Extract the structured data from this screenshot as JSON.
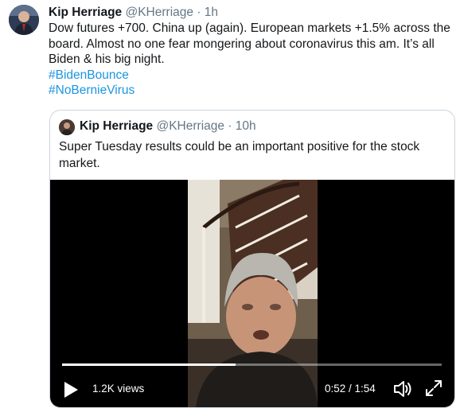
{
  "tweet": {
    "author_name": "Kip Herriage",
    "author_handle": "@KHerriage",
    "separator": "·",
    "time": "1h",
    "text": "Dow futures +700. China up (again). European markets +1.5% across the board. Almost no one fear mongering about coronavirus this am. It’s all Biden & his big night.",
    "hashtags": [
      "#BidenBounce",
      "#NoBernieVirus"
    ]
  },
  "quoted": {
    "author_name": "Kip Herriage",
    "author_handle": "@KHerriage",
    "separator": "·",
    "time": "10h",
    "text": "Super Tuesday results could be an important positive for the stock market."
  },
  "video": {
    "views": "1.2K views",
    "timecode": "0:52 / 1:54",
    "progress_fraction": 0.456
  },
  "colors": {
    "link": "#1b95e0",
    "muted": "#657786",
    "border": "#ccd6dd"
  },
  "icons": {
    "play": "play-icon",
    "volume": "volume-icon",
    "fullscreen": "fullscreen-icon"
  }
}
